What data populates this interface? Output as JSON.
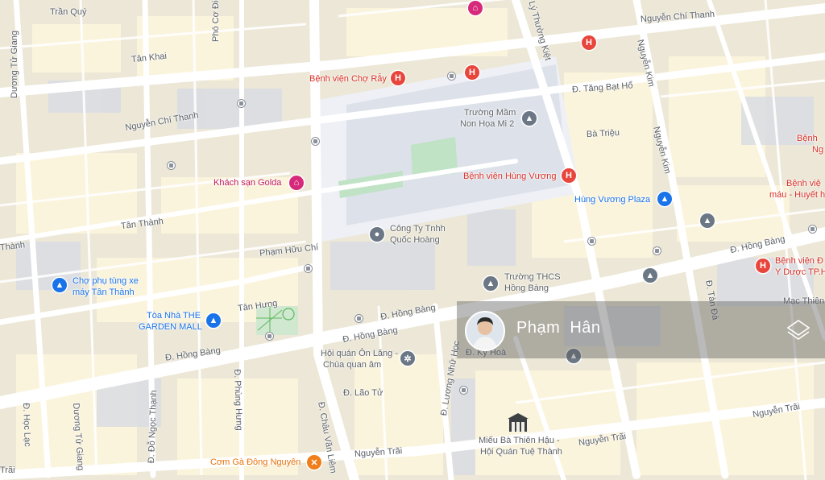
{
  "streets": {
    "tran_quy": "Trần Quý",
    "pho_co_dieu": "Phó Cơ Điều",
    "ly_thuong_kiet": "Lý Thường Kiệt",
    "nguyen_chi_thanh_1": "Nguyễn Chí Thanh",
    "nguyen_chi_thanh_2": "Nguyễn Chí Thanh",
    "duong_tu_giang_1": "Dương Tử Giang",
    "tan_khai": "Tân Khai",
    "nguyen_kim_1": "Nguyễn Kim",
    "tang_bat_ho": "Đ. Tăng Bạt Hổ",
    "ba_trieu": "Bà Triệu",
    "nguyen_kim_2": "Nguyễn Kim",
    "tan_thanh_1": "Tân Thành",
    "tan_thanh_2": "Thành",
    "pham_huu_chi": "Phạm Hữu Chí",
    "hong_bang_1": "Đ. Hồng Bàng",
    "tan_da": "Đ. Tản Đà",
    "mac_thien": "Mạc Thiên",
    "tan_hung": "Tân Hưng",
    "hong_bang_2": "Đ. Hồng Bàng",
    "hong_bang_3": "Đ. Hồng Bàng",
    "hong_bang_4": "Đ. Hồng Bàng",
    "ky_hoa": "Đ. Kỳ Hoà",
    "luong_nhu_hoc": "Đ. Lương Nhữ Học",
    "phung_hung": "Đ. Phùng Hưng",
    "lao_tu": "Đ. Lão Tử",
    "chau_van_liem": "Đ. Châu Văn Liêm",
    "hoc_lac": "Đ. Học Lạc",
    "duong_tu_giang_2": "Dương Tử Giang",
    "do_ngoc_thanh": "Đ. Đỗ Ngọc Thạnh",
    "nguyen_trai_1": "Nguyễn Trãi",
    "nguyen_trai_2": "Nguyễn Trãi",
    "nguyen_trai_3": "Nguyễn Trãi"
  },
  "pois": {
    "cho_ray": "Bệnh viện Chợ Rẫy",
    "mam_non_1": "Trường Mầm",
    "mam_non_2": "Non Họa Mi 2",
    "hung_vuong_hospital": "Bệnh viện Hùng Vương",
    "hung_vuong_plaza": "Hùng Vương Plaza",
    "golda": "Khách sạn Golda",
    "cong_ty_1": "Công Ty Tnhh",
    "cong_ty_2": "Quốc Hoàng",
    "cho_phu_tung_1": "Chợ phụ tùng xe",
    "cho_phu_tung_2": "máy Tân Thành",
    "garden_mall_1": "Tòa Nhà THE",
    "garden_mall_2": "GARDEN MALL",
    "thcs_1": "Trường THCS",
    "thcs_2": "Hồng Bàng",
    "hoi_quan_1": "Hội quán Ôn Lăng -",
    "hoi_quan_2": "Chùa quan âm",
    "mieu_1": "Miếu Bà Thiên Hậu -",
    "mieu_2": "Hội Quán Tuệ Thành",
    "com_ga": "Cơm Gà Đông Nguyên",
    "benh_vien_right_1": "Bệnh",
    "benh_vien_right_2": "Ng",
    "benh_vien_right_3": "Bệnh việ",
    "benh_vien_right_4": "máu - Huyết h",
    "benh_vien_dh_1": "Bệnh viện Đ",
    "benh_vien_dh_2": "Y Dược TP.H"
  },
  "overlay": {
    "name": "Phạm  Hân"
  },
  "colors": {
    "hospital": "#e8453c",
    "hotel": "#d6297a",
    "shopping": "#1a73e8",
    "school": "#6b7785",
    "food": "#f07f1b",
    "road": "#ffffff",
    "block": "#fbf4dc",
    "building": "#d9dce3"
  }
}
